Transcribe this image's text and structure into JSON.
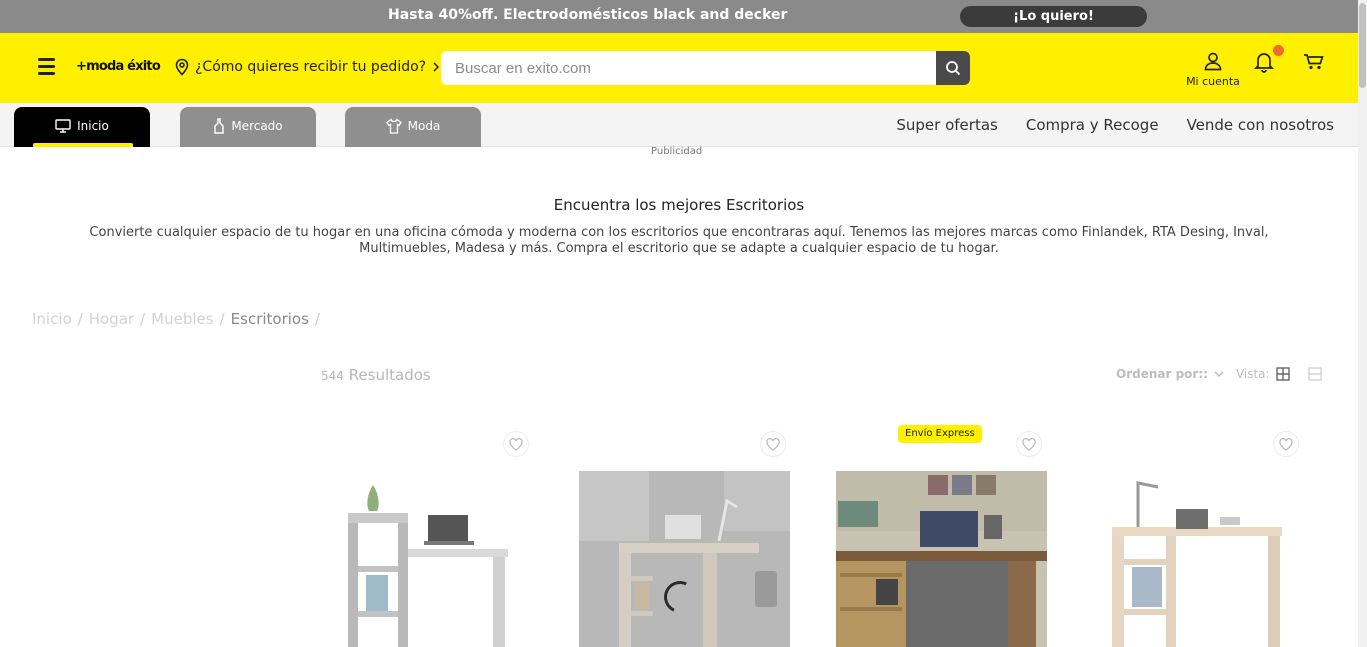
{
  "promo_bar": {
    "text": "Hasta 40%off. Electrodomésticos black and decker",
    "cta": "¡Lo quiero!"
  },
  "header": {
    "logo": "+moda éxito",
    "delivery_prompt": "¿Cómo quieres recibir tu pedido?",
    "search_placeholder": "Buscar en exito.com",
    "account_label": "Mi cuenta"
  },
  "nav": {
    "tabs": [
      {
        "label": "Inicio",
        "active": true
      },
      {
        "label": "Mercado",
        "active": false
      },
      {
        "label": "Moda",
        "active": false
      }
    ],
    "links": [
      "Super ofertas",
      "Compra y Recoge",
      "Vende con nosotros"
    ]
  },
  "ad_label": "Publicidad",
  "category": {
    "heading": "Encuentra los mejores Escritorios",
    "description": "Convierte cualquier espacio de tu hogar en una oficina cómoda y moderna con los escritorios que encontraras aquí. Tenemos las mejores marcas como Finlandek, RTA Desing, Inval, Multimuebles, Madesa y más. Compra el escritorio que se adapte a cualquier espacio de tu hogar."
  },
  "breadcrumb": [
    "Inicio",
    "Hogar",
    "Muebles",
    "Escritorios"
  ],
  "results": {
    "count": "544",
    "label": "Resultados"
  },
  "toolbar": {
    "sort_label": "Ordenar por::",
    "view_label": "Vista:"
  },
  "products": [
    {
      "image": "white-desk-with-shelves",
      "badge": ""
    },
    {
      "image": "light-wood-desk-room",
      "badge": ""
    },
    {
      "image": "gaming-desk-setup",
      "badge": "Envío Express"
    },
    {
      "image": "oak-desk-with-lamp",
      "badge": ""
    }
  ],
  "colors": {
    "brand_yellow": "#fff000",
    "promo_gray": "#8a8a8a",
    "notification": "#f26b2e"
  }
}
